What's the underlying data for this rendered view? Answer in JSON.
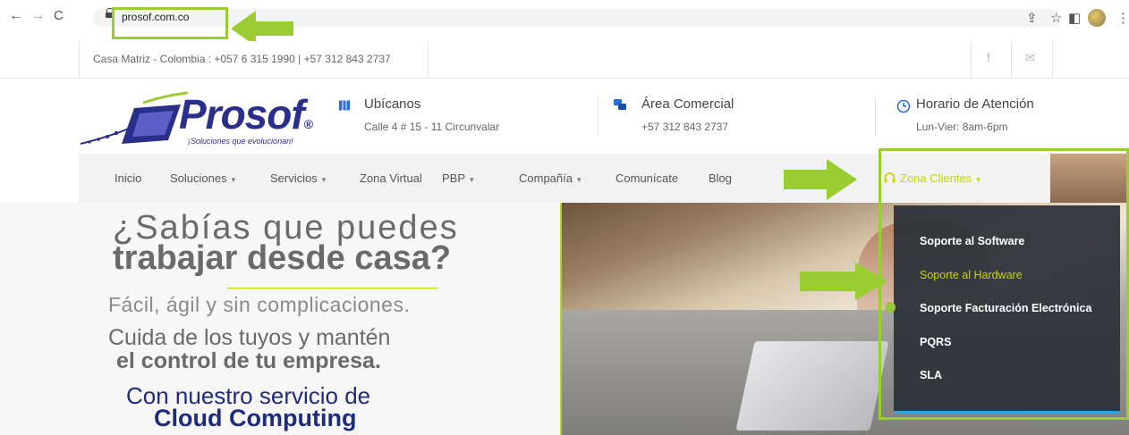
{
  "browser": {
    "url": "prosof.com.co",
    "back_glyph": "←",
    "forward_glyph": "→",
    "reload_glyph": "C",
    "share_glyph": "⇪",
    "star_glyph": "☆",
    "panel_glyph": "◧",
    "menu_glyph": "⋮"
  },
  "topbar": {
    "contact": "Casa Matriz - Colombia : +057 6 315 1990 | +57 312 843 2737",
    "facebook": "f",
    "email": "✉"
  },
  "logo": {
    "name": "Prosof",
    "registered": "®",
    "tagline": "¡Soluciones que evolucionan!"
  },
  "header": {
    "location": {
      "title": "Ubícanos",
      "sub": "Calle 4 # 15 - 11 Circunvalar"
    },
    "commercial": {
      "title": "Área Comercial",
      "sub": "+57 312 843 2737"
    },
    "hours": {
      "title": "Horario de Atención",
      "sub": "Lun-Vier: 8am-6pm"
    }
  },
  "nav": {
    "inicio": "Inicio",
    "soluciones": "Soluciones",
    "servicios": "Servicios",
    "zona_virtual": "Zona Virtual",
    "pbp": "PBP",
    "compania": "Compañía",
    "comunicate": "Comunícate",
    "blog": "Blog",
    "zona_clientes": "Zona Clientes",
    "caret": "▾"
  },
  "dropdown": {
    "items": [
      "Soporte al Software",
      "Soporte al Hardware",
      "Soporte Facturación Electrónica",
      "PQRS",
      "SLA"
    ]
  },
  "hero": {
    "line1": "¿Sabías que puedes",
    "line2": "trabajar desde casa?",
    "line3": "Fácil, ágil y sin complicaciones.",
    "line4": "Cuida de los tuyos y mantén",
    "line5": "el control de tu empresa.",
    "line6": "Con nuestro servicio de",
    "line7": "Cloud Computing"
  },
  "colors": {
    "brand": "#2b2f8c",
    "accent": "#c8d400",
    "highlight": "#9acd32",
    "dropdown_bg": "#2d3238",
    "dropdown_underline": "#2aa7d8"
  }
}
